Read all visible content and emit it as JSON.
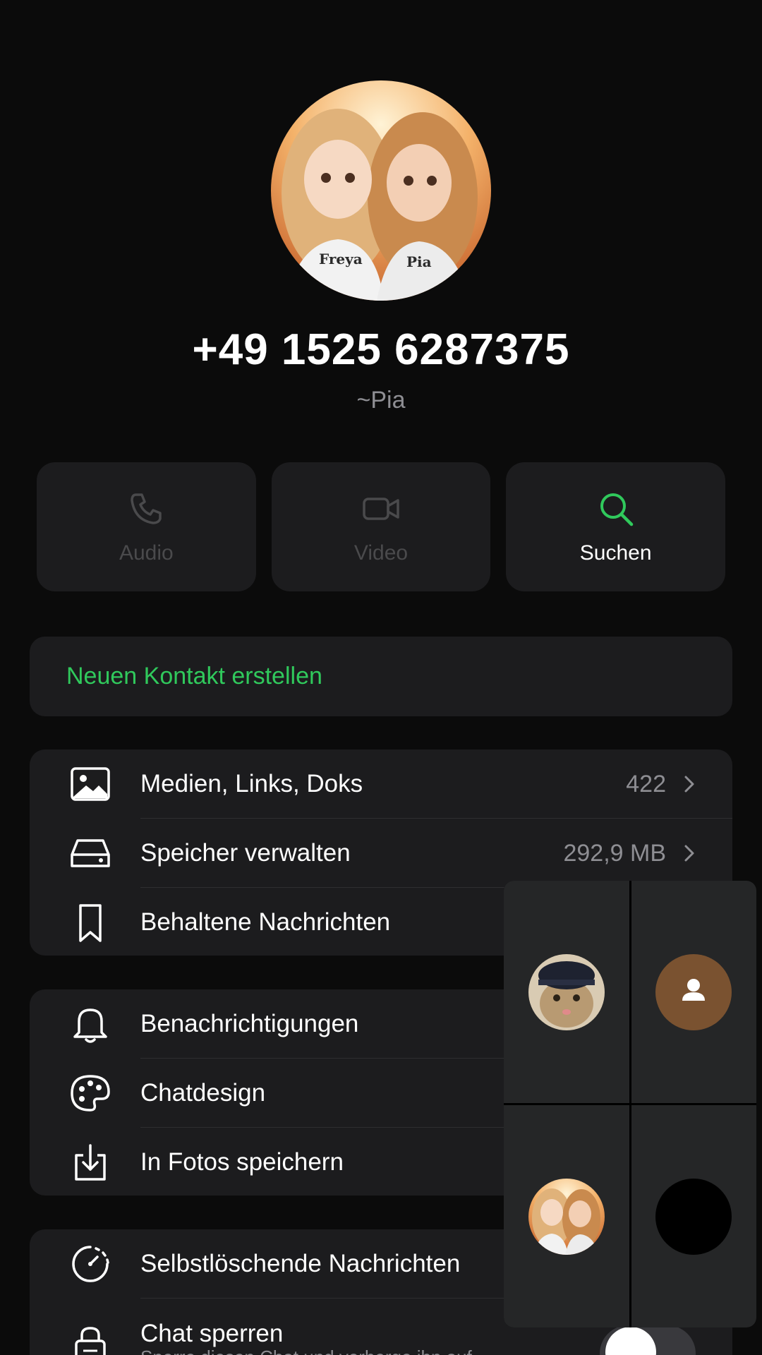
{
  "profile": {
    "phone": "+49 1525 6287375",
    "alias": "~Pia",
    "avatar_shirt_names": [
      "Freya",
      "Pia"
    ]
  },
  "actions": [
    {
      "label": "Audio",
      "icon": "phone-icon",
      "enabled": false
    },
    {
      "label": "Video",
      "icon": "video-camera-icon",
      "enabled": false
    },
    {
      "label": "Suchen",
      "icon": "search-icon",
      "enabled": true
    }
  ],
  "new_contact": {
    "label": "Neuen Kontakt erstellen"
  },
  "media_section": [
    {
      "label": "Medien, Links, Doks",
      "value": "422",
      "icon": "image-icon"
    },
    {
      "label": "Speicher verwalten",
      "value": "292,9 MB",
      "icon": "storage-drive-icon"
    },
    {
      "label": "Behaltene Nachrichten",
      "icon": "bookmark-icon"
    }
  ],
  "settings_section": [
    {
      "label": "Benachrichtigungen",
      "icon": "bell-icon"
    },
    {
      "label": "Chatdesign",
      "icon": "palette-icon"
    },
    {
      "label": "In Fotos speichern",
      "icon": "save-to-photos-icon"
    }
  ],
  "privacy_section": [
    {
      "label": "Selbstlöschende Nachrichten",
      "icon": "timer-icon"
    },
    {
      "label": "Chat sperren",
      "sublabel": "Sperre diesen Chat und verberge ihn auf",
      "icon": "lock-icon"
    }
  ],
  "colors": {
    "accent_green": "#30c95c",
    "card_bg": "#1c1c1e",
    "page_bg": "#0b0b0b",
    "secondary_text": "#8e8e93",
    "placeholder_avatar": "#7a5230"
  }
}
